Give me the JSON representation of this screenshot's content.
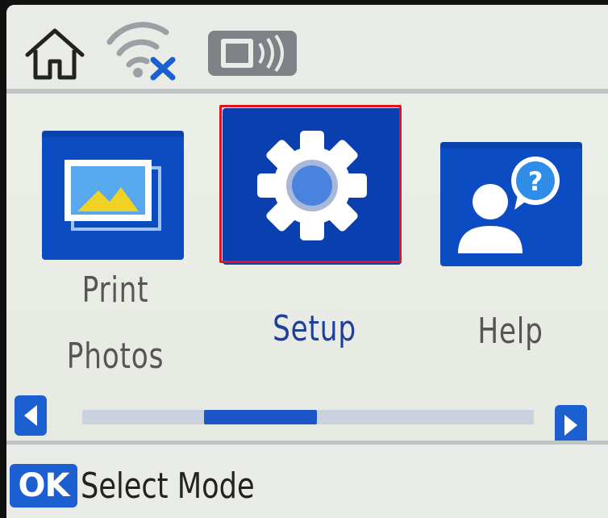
{
  "status_bar": {
    "home_icon": "home-icon",
    "wifi_icon": "wifi-disconnected-icon",
    "nfc_icon": "nfc-icon"
  },
  "menu": {
    "items": [
      {
        "id": "print-photos",
        "label_line1": "Print",
        "label_line2": "Photos",
        "icon": "photo-icon",
        "selected": false
      },
      {
        "id": "setup",
        "label": "Setup",
        "icon": "gear-icon",
        "selected": true
      },
      {
        "id": "help",
        "label": "Help",
        "icon": "help-person-icon",
        "selected": false
      }
    ]
  },
  "scroll": {
    "left_icon": "arrow-left-icon",
    "right_icon": "arrow-right-icon",
    "thumb_start_fraction": 0.27,
    "thumb_width_fraction": 0.25
  },
  "bottom_bar": {
    "ok_label": "OK",
    "hint": "Select Mode"
  },
  "colors": {
    "accent_blue": "#0a47b8",
    "selection_red": "#e1131c",
    "selected_label": "#1f3f9a"
  }
}
